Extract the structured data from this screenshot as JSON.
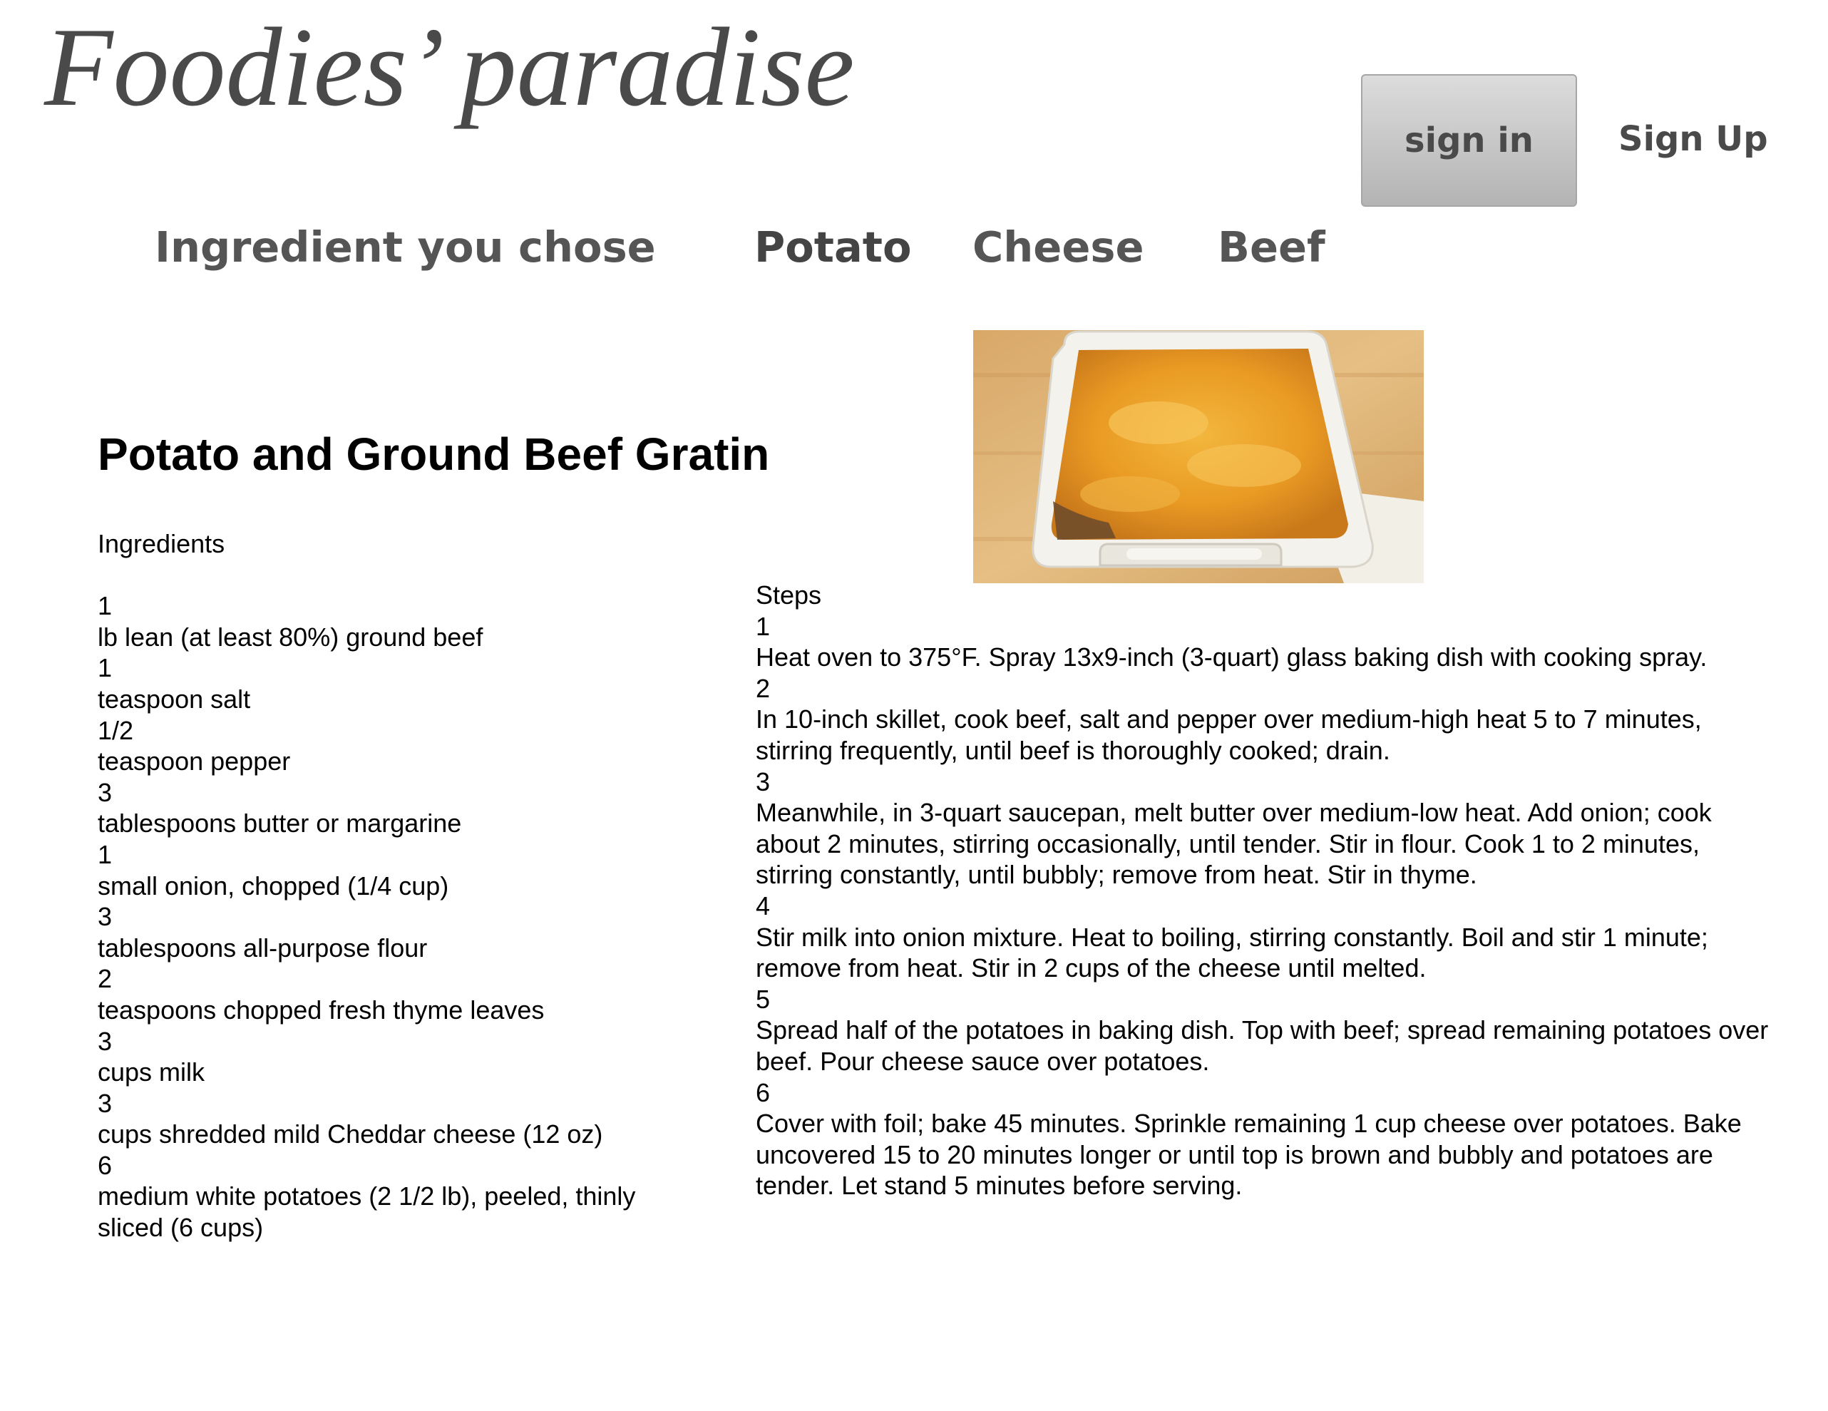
{
  "site": {
    "logo": "Foodies’ paradise"
  },
  "auth": {
    "sign_in_label": "sign in",
    "sign_up_label": "Sign Up"
  },
  "ingredient_bar": {
    "label": "Ingredient you chose",
    "chips": [
      "Potato",
      "Cheese",
      "Beef"
    ],
    "active_chip": "Potato"
  },
  "recipe": {
    "title": "Potato and Ground Beef Gratin",
    "ingredients_heading": "Ingredients",
    "ingredients": [
      {
        "qty": "1",
        "item": "lb lean (at least 80%) ground beef"
      },
      {
        "qty": "1",
        "item": "teaspoon salt"
      },
      {
        "qty": "1/2",
        "item": "teaspoon pepper"
      },
      {
        "qty": "3",
        "item": "tablespoons butter or margarine"
      },
      {
        "qty": "1",
        "item": "small onion, chopped (1/4 cup)"
      },
      {
        "qty": "3",
        "item": "tablespoons all-purpose flour"
      },
      {
        "qty": "2",
        "item": "teaspoons chopped fresh thyme leaves"
      },
      {
        "qty": "3",
        "item": "cups milk"
      },
      {
        "qty": "3",
        "item": "cups shredded mild Cheddar cheese (12 oz)"
      },
      {
        "qty": "6",
        "item": "medium white potatoes (2 1/2 lb), peeled, thinly sliced (6 cups)"
      }
    ],
    "steps_heading": "Steps",
    "steps": [
      {
        "num": "1",
        "text": "Heat oven to 375°F. Spray 13x9-inch (3-quart) glass baking dish with cooking spray."
      },
      {
        "num": "2",
        "text": "In 10-inch skillet, cook beef, salt and pepper over medium-high heat 5 to 7 minutes, stirring frequently, until beef is thoroughly cooked; drain."
      },
      {
        "num": "3",
        "text": "Meanwhile, in 3-quart saucepan, melt butter over medium-low heat. Add onion; cook about 2 minutes, stirring occasionally, until tender. Stir in flour. Cook 1 to 2 minutes, stirring constantly, until bubbly; remove from heat. Stir in thyme."
      },
      {
        "num": "4",
        "text": "Stir milk into onion mixture. Heat to boiling, stirring constantly. Boil and stir 1 minute; remove from heat. Stir in 2 cups of the cheese until melted."
      },
      {
        "num": "5",
        "text": "Spread half of the potatoes in baking dish. Top with beef; spread remaining potatoes over beef. Pour cheese sauce over potatoes."
      },
      {
        "num": "6",
        "text": "Cover with foil; bake 45 minutes. Sprinkle remaining 1 cup cheese over potatoes. Bake uncovered 15 to 20 minutes longer or until top is brown and bubbly and potatoes are tender. Let stand 5 minutes before serving."
      }
    ]
  },
  "colors": {
    "text_gray": "#4a4a4a",
    "button_gray": "#c8c8c8",
    "body_text": "#000000"
  }
}
